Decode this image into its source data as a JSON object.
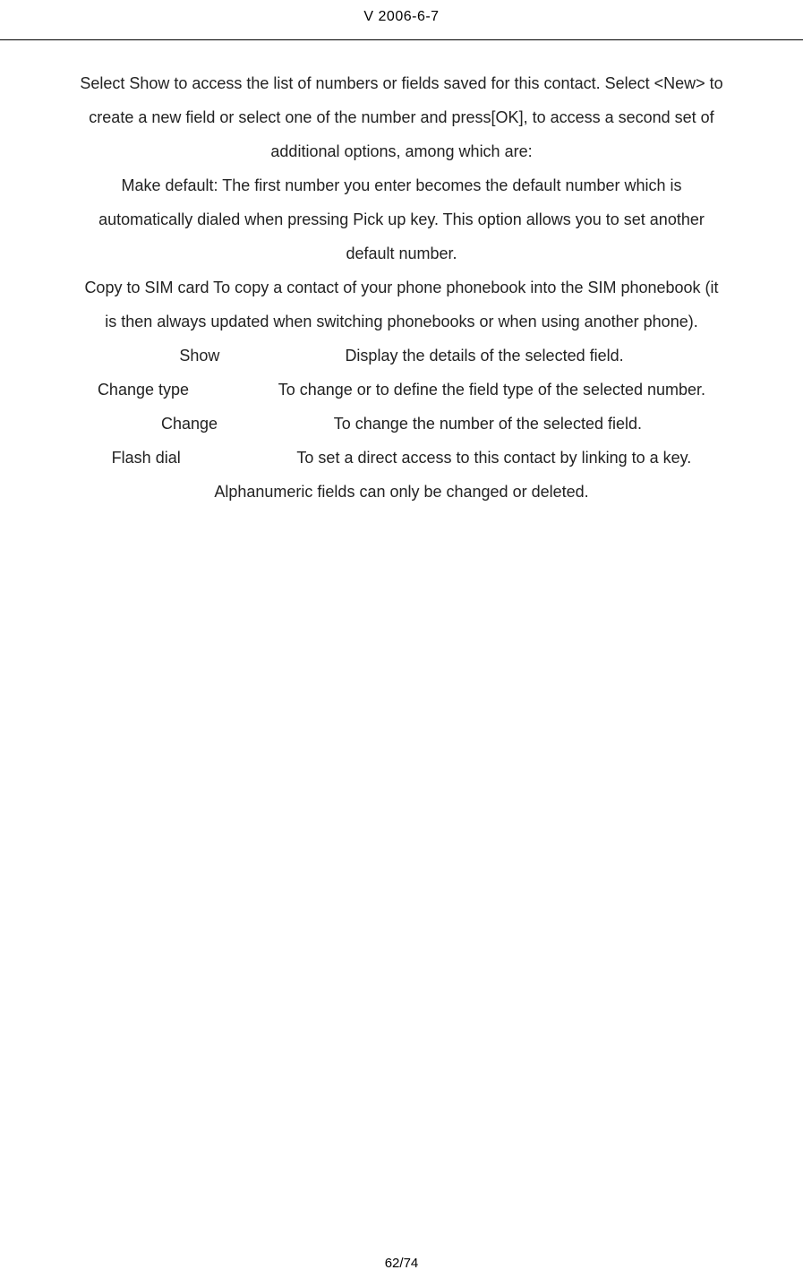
{
  "header": {
    "version": "V 2006-6-7"
  },
  "content": {
    "intro1": "Select Show to access the list of numbers or fields saved for this contact. Select <New> to",
    "intro2": "create a new field or select one of the number and press[OK], to access a second set of",
    "intro3": "additional options, among which are:",
    "makeDefault1": "Make default: The first number you enter becomes the default number which is",
    "makeDefault2": "automatically dialed when pressing Pick up key. This option allows you to set another",
    "makeDefault3": "default number.",
    "copyToSim1": "Copy to SIM card     To copy a contact of your phone phonebook into the SIM phonebook (it",
    "copyToSim2": "is then always updated when switching phonebooks or when using another phone).",
    "options": {
      "show": {
        "label": "Show",
        "description": "Display the details of the selected field."
      },
      "changeType": {
        "label": "Change type",
        "description": "To change or to define the field type of the selected number."
      },
      "change": {
        "label": "Change",
        "description": "To change the number of the selected field."
      },
      "flashDial": {
        "label": "Flash dial",
        "description": "To set a direct access to this contact by linking to a key."
      }
    },
    "note": "Alphanumeric fields can only be changed or deleted."
  },
  "footer": {
    "pageNumber": "62/74"
  }
}
